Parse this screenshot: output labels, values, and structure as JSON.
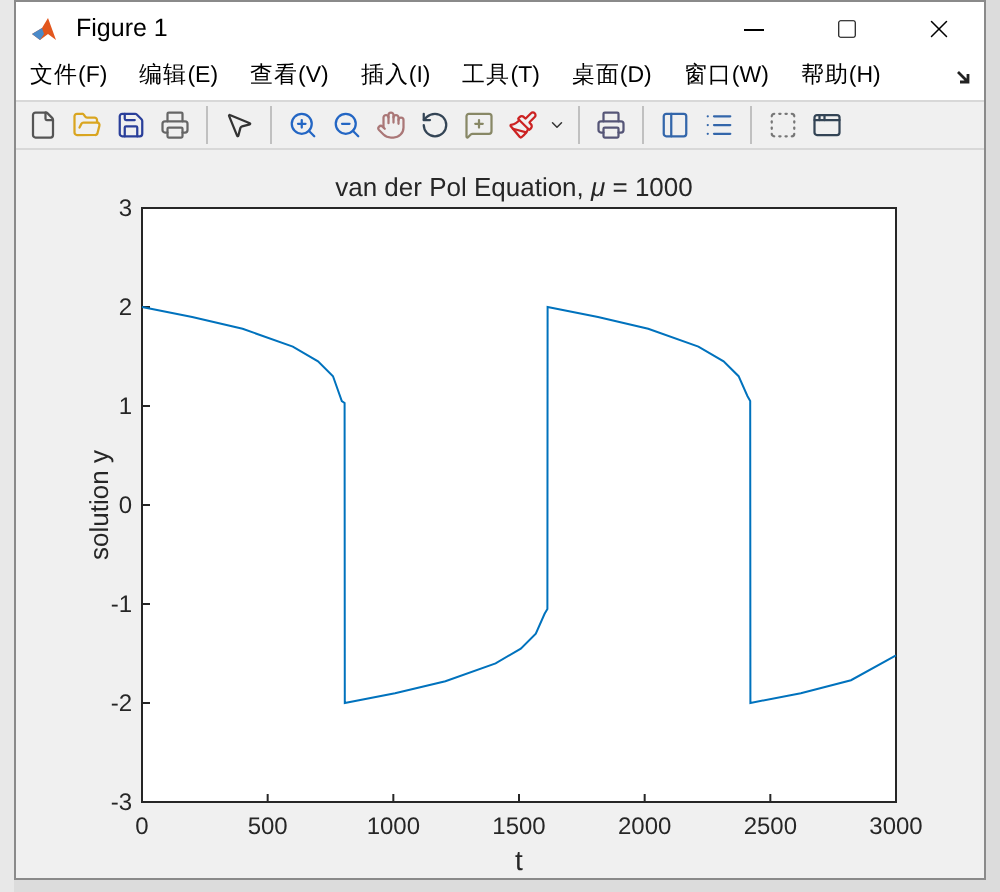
{
  "window": {
    "title": "Figure 1"
  },
  "menu": [
    "文件(F)",
    "编辑(E)",
    "查看(V)",
    "插入(I)",
    "工具(T)",
    "桌面(D)",
    "窗口(W)",
    "帮助(H)"
  ],
  "toolbar": [
    {
      "kind": "new"
    },
    {
      "kind": "open"
    },
    {
      "kind": "save"
    },
    {
      "kind": "print"
    },
    {
      "kind": "sep"
    },
    {
      "kind": "pointer"
    },
    {
      "kind": "sep"
    },
    {
      "kind": "zoom-in"
    },
    {
      "kind": "zoom-out"
    },
    {
      "kind": "pan"
    },
    {
      "kind": "rotate"
    },
    {
      "kind": "cursor"
    },
    {
      "kind": "brush"
    },
    {
      "kind": "sep"
    },
    {
      "kind": "link"
    },
    {
      "kind": "sep"
    },
    {
      "kind": "colorbar"
    },
    {
      "kind": "legend"
    },
    {
      "kind": "sep"
    },
    {
      "kind": "hide"
    },
    {
      "kind": "show"
    }
  ],
  "figure": {
    "title": "van der Pol Equation, *μ* = 1000",
    "chart_data": {
      "type": "line",
      "xlabel": "t",
      "ylabel": "solution y",
      "xlim": [
        0,
        3000
      ],
      "ylim": [
        -3,
        3
      ],
      "xticks": [
        0,
        500,
        1000,
        1500,
        2000,
        2500,
        3000
      ],
      "yticks": [
        -3,
        -2,
        -1,
        0,
        1,
        2,
        3
      ],
      "x": [
        0,
        200,
        400,
        600,
        700,
        760,
        795,
        806,
        807,
        1007,
        1207,
        1407,
        1507,
        1567,
        1602,
        1613,
        1614,
        1814,
        2014,
        2214,
        2314,
        2374,
        2409,
        2420,
        2421,
        2621,
        2821,
        3000
      ],
      "series": [
        {
          "color": "#0072bd",
          "values": [
            2,
            1.9,
            1.78,
            1.6,
            1.45,
            1.3,
            1.05,
            1.03,
            -2,
            -1.9,
            -1.78,
            -1.6,
            -1.45,
            -1.3,
            -1.1,
            -1.05,
            2,
            1.9,
            1.78,
            1.6,
            1.45,
            1.3,
            1.1,
            1.05,
            -2,
            -1.9,
            -1.77,
            -1.52
          ]
        }
      ]
    }
  }
}
